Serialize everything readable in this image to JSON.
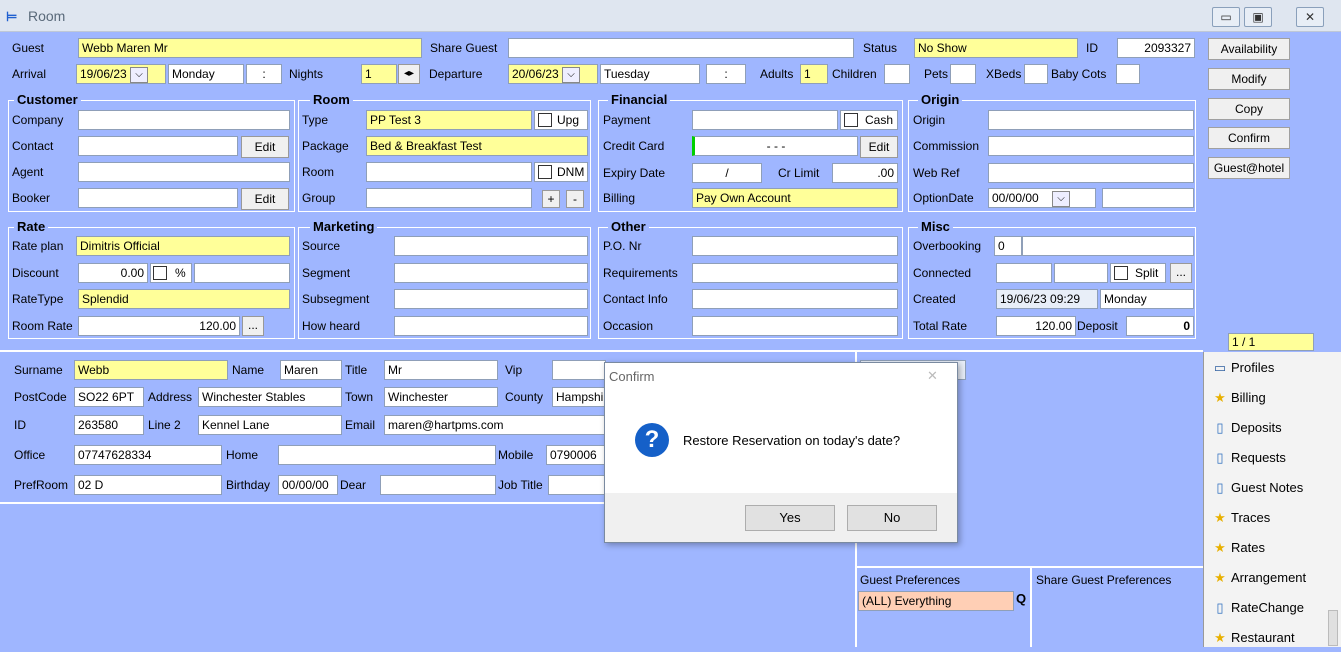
{
  "window": {
    "title": "Room",
    "controls": [
      "▭",
      "▣",
      "✕"
    ]
  },
  "top": {
    "guest_label": "Guest",
    "guest": "Webb Maren Mr",
    "share_guest_label": "Share Guest",
    "share_guest": "",
    "status_label": "Status",
    "status": "No Show",
    "id_label": "ID",
    "id": "2093327",
    "arrival_label": "Arrival",
    "arrival": "19/06/23",
    "arrival_day": "Monday",
    "arrival_time": ":",
    "nights_label": "Nights",
    "nights": "1",
    "departure_label": "Departure",
    "departure": "20/06/23",
    "departure_day": "Tuesday",
    "departure_time": ":",
    "adults_label": "Adults",
    "adults": "1",
    "children_label": "Children",
    "children": "",
    "pets_label": "Pets",
    "xbeds_label": "XBeds",
    "babycots_label": "Baby Cots"
  },
  "customer": {
    "title": "Customer",
    "company_label": "Company",
    "contact_label": "Contact",
    "agent_label": "Agent",
    "booker_label": "Booker",
    "edit": "Edit"
  },
  "room": {
    "title": "Room",
    "type_label": "Type",
    "type": "PP Test 3",
    "upg": "Upg",
    "package_label": "Package",
    "package": "Bed & Breakfast Test",
    "room_label": "Room",
    "dnm": "DNM",
    "group_label": "Group",
    "plus": "+",
    "minus": "-"
  },
  "financial": {
    "title": "Financial",
    "payment_label": "Payment",
    "cash": "Cash",
    "credit_card_label": "Credit Card",
    "credit_card": "-   -   -",
    "edit": "Edit",
    "expiry_label": "Expiry Date",
    "expiry": "/",
    "cr_limit_label": "Cr Limit",
    "cr_limit": ".00",
    "billing_label": "Billing",
    "billing": "Pay Own Account"
  },
  "origin": {
    "title": "Origin",
    "origin_label": "Origin",
    "commission_label": "Commission",
    "webref_label": "Web Ref",
    "optiondate_label": "OptionDate",
    "optiondate": "00/00/00"
  },
  "rate": {
    "title": "Rate",
    "rateplan_label": "Rate plan",
    "rateplan": "Dimitris Official",
    "discount_label": "Discount",
    "discount": "0.00",
    "pct": "%",
    "ratetype_label": "RateType",
    "ratetype": "Splendid",
    "roomrate_label": "Room Rate",
    "roomrate": "120.00",
    "more": "..."
  },
  "marketing": {
    "title": "Marketing",
    "source_label": "Source",
    "segment_label": "Segment",
    "subsegment_label": "Subsegment",
    "howheard_label": "How heard"
  },
  "other": {
    "title": "Other",
    "po_label": "P.O. Nr",
    "requirements_label": "Requirements",
    "contactinfo_label": "Contact Info",
    "occasion_label": "Occasion"
  },
  "misc": {
    "title": "Misc",
    "overbooking_label": "Overbooking",
    "overbooking": "0",
    "connected_label": "Connected",
    "split": "Split",
    "more": "...",
    "created_label": "Created",
    "created": "19/06/23 09:29",
    "created_day": "Monday",
    "totalrate_label": "Total Rate",
    "totalrate": "120.00",
    "deposit_label": "Deposit",
    "deposit": "0"
  },
  "sidebuttons": [
    "Availability",
    "Modify",
    "Copy",
    "Confirm",
    "Guest@hotel"
  ],
  "pager": "1 / 1",
  "profile": {
    "surname_label": "Surname",
    "surname": "Webb",
    "name_label": "Name",
    "name": "Maren",
    "title_label": "Title",
    "title": "Mr",
    "vip_label": "Vip",
    "postcode_label": "PostCode",
    "postcode": "SO22 6PT",
    "address_label": "Address",
    "address": "Winchester Stables",
    "town_label": "Town",
    "town": "Winchester",
    "county_label": "County",
    "county": "Hampshi",
    "id_label": "ID",
    "id": "263580",
    "line2_label": "Line 2",
    "line2": "Kennel Lane",
    "email_label": "Email",
    "email": "maren@hartpms.com",
    "office_label": "Office",
    "office": "07747628334",
    "home_label": "Home",
    "mobile_label": "Mobile",
    "mobile": "0790006",
    "prefroom_label": "PrefRoom",
    "prefroom": "02 D",
    "birthday_label": "Birthday",
    "birthday": "00/00/00",
    "dear_label": "Dear",
    "jobtitle_label": "Job Title"
  },
  "preferences": {
    "guest_label": "Guest Preferences",
    "guest_value": "(ALL) Everything",
    "share_label": "Share Guest Preferences"
  },
  "sidelist": [
    {
      "icon": "profiles-icon",
      "glyph": "▭",
      "label": "Profiles"
    },
    {
      "icon": "star-icon",
      "glyph": "★",
      "label": "Billing"
    },
    {
      "icon": "page-icon",
      "glyph": "▯",
      "label": "Deposits"
    },
    {
      "icon": "page-icon",
      "glyph": "▯",
      "label": "Requests"
    },
    {
      "icon": "page-icon",
      "glyph": "▯",
      "label": "Guest Notes"
    },
    {
      "icon": "star-icon",
      "glyph": "★",
      "label": "Traces"
    },
    {
      "icon": "star-icon",
      "glyph": "★",
      "label": "Rates"
    },
    {
      "icon": "star-icon",
      "glyph": "★",
      "label": "Arrangement"
    },
    {
      "icon": "page-icon",
      "glyph": "▯",
      "label": "RateChange"
    },
    {
      "icon": "star-icon",
      "glyph": "★",
      "label": "Restaurant"
    }
  ],
  "dialog": {
    "title": "Confirm",
    "close": "✕",
    "message": "Restore Reservation on today's date?",
    "yes": "Yes",
    "no": "No"
  },
  "colors": {
    "background": "#9fb6ff",
    "highlight": "#ffff99",
    "preference": "#ffcfb5",
    "question_icon": "#1560c8"
  }
}
